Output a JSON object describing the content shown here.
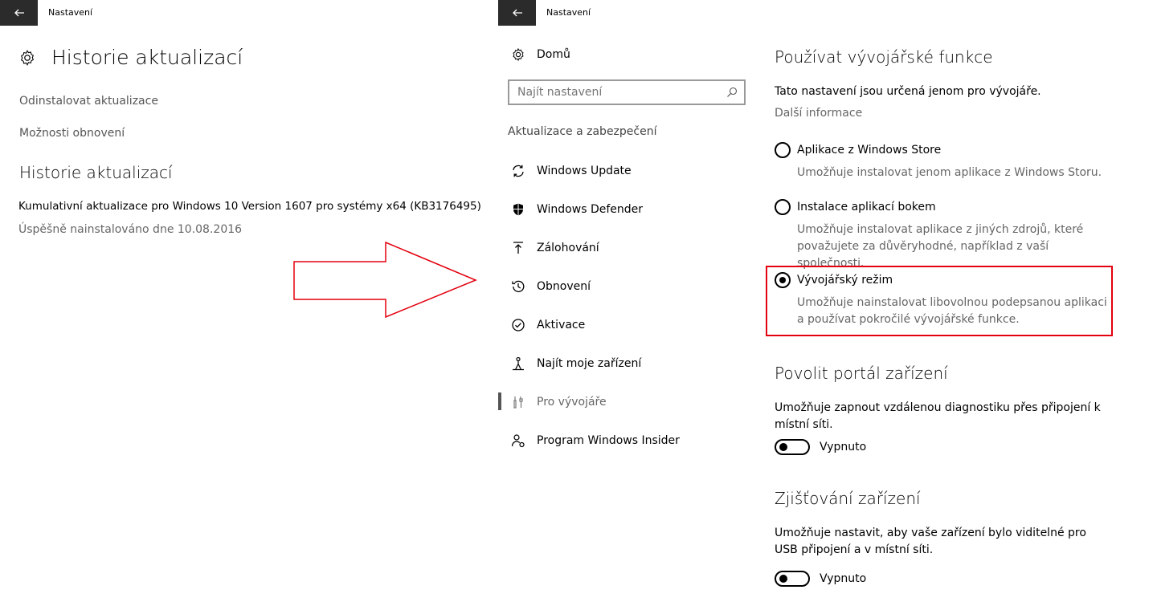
{
  "left": {
    "window_title": "Nastavení",
    "page_title": "Historie aktualizací",
    "links": [
      "Odinstalovat aktualizace",
      "Možnosti obnovení"
    ],
    "section_title": "Historie aktualizací",
    "update_name": "Kumulativní aktualizace pro Windows 10 Version 1607 pro systémy x64 (KB3176495)",
    "update_status": "Úspěšně nainstalováno dne 10.08.2016"
  },
  "right": {
    "window_title": "Nastavení",
    "nav": {
      "home": "Domů",
      "search_placeholder": "Najít nastavení",
      "group": "Aktualizace a zabezpečení",
      "items": [
        {
          "label": "Windows Update",
          "icon": "refresh-icon"
        },
        {
          "label": "Windows Defender",
          "icon": "shield-icon"
        },
        {
          "label": "Zálohování",
          "icon": "upload-icon"
        },
        {
          "label": "Obnovení",
          "icon": "history-icon"
        },
        {
          "label": "Aktivace",
          "icon": "check-circle-icon"
        },
        {
          "label": "Najít moje zařízení",
          "icon": "person-pin-icon"
        },
        {
          "label": "Pro vývojáře",
          "icon": "developer-tools-icon"
        },
        {
          "label": "Program Windows Insider",
          "icon": "insider-icon"
        }
      ],
      "active_index": 6
    },
    "content": {
      "title": "Používat vývojářské funkce",
      "subtitle": "Tato nastavení jsou určená jenom pro vývojáře.",
      "more_info": "Další informace",
      "options": [
        {
          "label": "Aplikace z Windows Store",
          "desc": "Umožňuje instalovat jenom aplikace z Windows Storu.",
          "checked": false
        },
        {
          "label": "Instalace aplikací bokem",
          "desc": "Umožňuje instalovat aplikace z jiných zdrojů, které považujete za důvěryhodné, například z vaší společnosti.",
          "checked": false
        },
        {
          "label": "Vývojářský režim",
          "desc": "Umožňuje nainstalovat libovolnou podepsanou aplikaci a používat pokročilé vývojářské funkce.",
          "checked": true
        }
      ],
      "portal": {
        "title": "Povolit portál zařízení",
        "desc": "Umožňuje zapnout vzdálenou diagnostiku přes připojení k místní síti.",
        "toggle_label": "Vypnuto"
      },
      "discovery": {
        "title": "Zjišťování zařízení",
        "desc": "Umožňuje nastavit, aby vaše zařízení bylo viditelné pro USB připojení a v místní síti.",
        "toggle_label": "Vypnuto"
      }
    }
  },
  "colors": {
    "titlebar_button": "#2b2b2b",
    "highlight": "#e3000f",
    "arrow": "#e3000f"
  }
}
